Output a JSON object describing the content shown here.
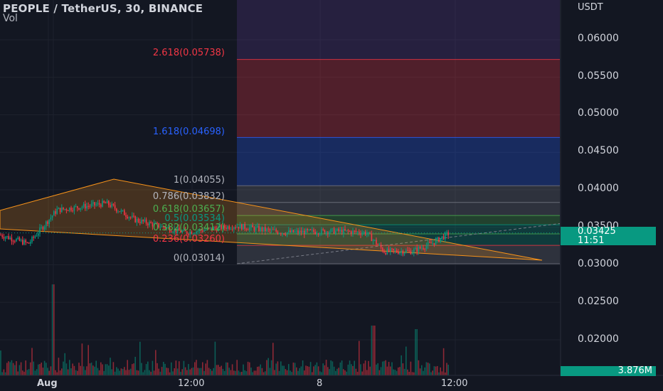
{
  "header": {
    "title": "PEOPLE / TetherUS, 30, BINANCE",
    "indicator": "Vol"
  },
  "axis": {
    "unit": "USDT",
    "y_labels": [
      "0.06000",
      "0.05500",
      "0.05000",
      "0.04500",
      "0.04000",
      "0.03500",
      "0.03000",
      "0.02500",
      "0.02000"
    ],
    "x_labels": [
      "Aug",
      "12:00",
      "8",
      "12:00"
    ]
  },
  "fib_labels": [
    "2.618(0.05738)",
    "1.618(0.04698)",
    "1(0.04055)",
    "0.786(0.03832)",
    "0.618(0.03657)",
    "0.5(0.03534)",
    "0.382(0.03412)",
    "0.236(0.03260)",
    "0(0.03014)"
  ],
  "last_price": {
    "value": "0.03425",
    "countdown": "11:51"
  },
  "volume_value": "3.876M",
  "colors": {
    "up": "#089981",
    "down": "#f23645",
    "background": "#131722",
    "pattern": "#f7931a",
    "fib_blue": "#2962ff",
    "fib_red": "#f23645"
  },
  "chart_data": {
    "type": "candlestick",
    "symbol": "PEOPLE/USDT",
    "timeframe": "30",
    "y_ticks": [
      0.06,
      0.055,
      0.05,
      0.045,
      0.04,
      0.035,
      0.03,
      0.025,
      0.02
    ],
    "fib_levels": [
      {
        "ratio": "2.618",
        "price": 0.05738
      },
      {
        "ratio": "1.618",
        "price": 0.04698
      },
      {
        "ratio": "1",
        "price": 0.04055
      },
      {
        "ratio": "0.786",
        "price": 0.03832
      },
      {
        "ratio": "0.618",
        "price": 0.03657
      },
      {
        "ratio": "0.5",
        "price": 0.03534
      },
      {
        "ratio": "0.382",
        "price": 0.03412
      },
      {
        "ratio": "0.236",
        "price": 0.0326
      },
      {
        "ratio": "0",
        "price": 0.03014
      }
    ],
    "last_price": 0.03425,
    "last_volume": "3.876M"
  }
}
